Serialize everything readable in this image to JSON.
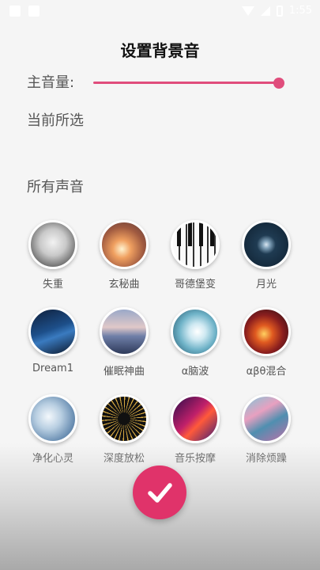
{
  "status_bar": {
    "time": "1:55"
  },
  "header": {
    "title": "设置背景音"
  },
  "volume": {
    "label": "主音量:",
    "level_percent": 100,
    "accent": "#e04d7c"
  },
  "current": {
    "label": "当前所选"
  },
  "sounds": {
    "section_label": "所有声音",
    "items": [
      {
        "label": "失重",
        "icon": "astronaut-image"
      },
      {
        "label": "玄秘曲",
        "icon": "sunset-image"
      },
      {
        "label": "哥德堡变",
        "icon": "piano-keys-image"
      },
      {
        "label": "月光",
        "icon": "moon-image"
      },
      {
        "label": "Dream1",
        "icon": "night-city-image"
      },
      {
        "label": "催眠神曲",
        "icon": "swans-lake-image"
      },
      {
        "label": "α脑波",
        "icon": "brain-image"
      },
      {
        "label": "αβθ混合",
        "icon": "fire-burst-image"
      },
      {
        "label": "净化心灵",
        "icon": "ice-crystal-image"
      },
      {
        "label": "深度放松",
        "icon": "radial-lines-image"
      },
      {
        "label": "音乐按摩",
        "icon": "neon-wave-image"
      },
      {
        "label": "消除烦躁",
        "icon": "marble-swirl-image"
      }
    ]
  },
  "confirm": {
    "icon": "checkmark-icon",
    "color": "#e0336a"
  }
}
